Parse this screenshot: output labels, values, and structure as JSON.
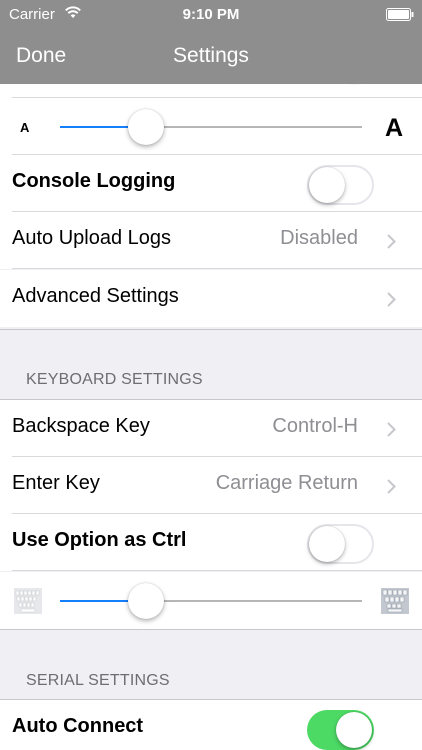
{
  "status_bar": {
    "carrier": "Carrier",
    "time": "9:10 PM"
  },
  "nav": {
    "done_label": "Done",
    "title": "Settings"
  },
  "font_slider": {
    "value_fraction": 0.25
  },
  "rows": {
    "console_logging": {
      "label": "Console Logging",
      "on": false
    },
    "auto_upload": {
      "label": "Auto Upload Logs",
      "value": "Disabled"
    },
    "advanced": {
      "label": "Advanced Settings"
    }
  },
  "keyboard_section": {
    "header": "KEYBOARD SETTINGS",
    "backspace": {
      "label": "Backspace Key",
      "value": "Control-H"
    },
    "enter": {
      "label": "Enter Key",
      "value": "Carriage Return"
    },
    "option_ctrl": {
      "label": "Use Option as Ctrl",
      "on": false
    },
    "keyboard_slider": {
      "value_fraction": 0.25
    }
  },
  "serial_section": {
    "header": "SERIAL SETTINGS",
    "auto_connect": {
      "label": "Auto Connect",
      "on": true
    }
  },
  "colors": {
    "accent": "#157efb",
    "switch_on": "#4cd964",
    "nav_bg": "#8e8e8e"
  }
}
